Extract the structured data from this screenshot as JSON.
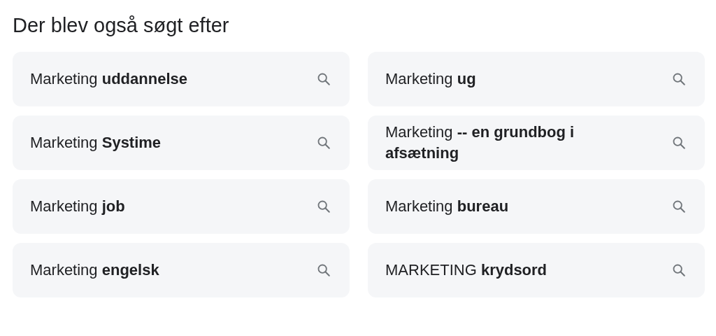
{
  "heading": "Der blev også søgt efter",
  "suggestions": [
    {
      "text": "Marketing **uddannelse**"
    },
    {
      "text": "Marketing **Systime**"
    },
    {
      "text": "Marketing **job**"
    },
    {
      "text": "Marketing **engelsk**"
    },
    {
      "text": "Marketing **ug**"
    },
    {
      "text": "Marketing **-- en grundbog i afsætning**"
    },
    {
      "text": "Marketing **bureau**"
    },
    {
      "text": "MARKETING **krydsord**"
    }
  ]
}
